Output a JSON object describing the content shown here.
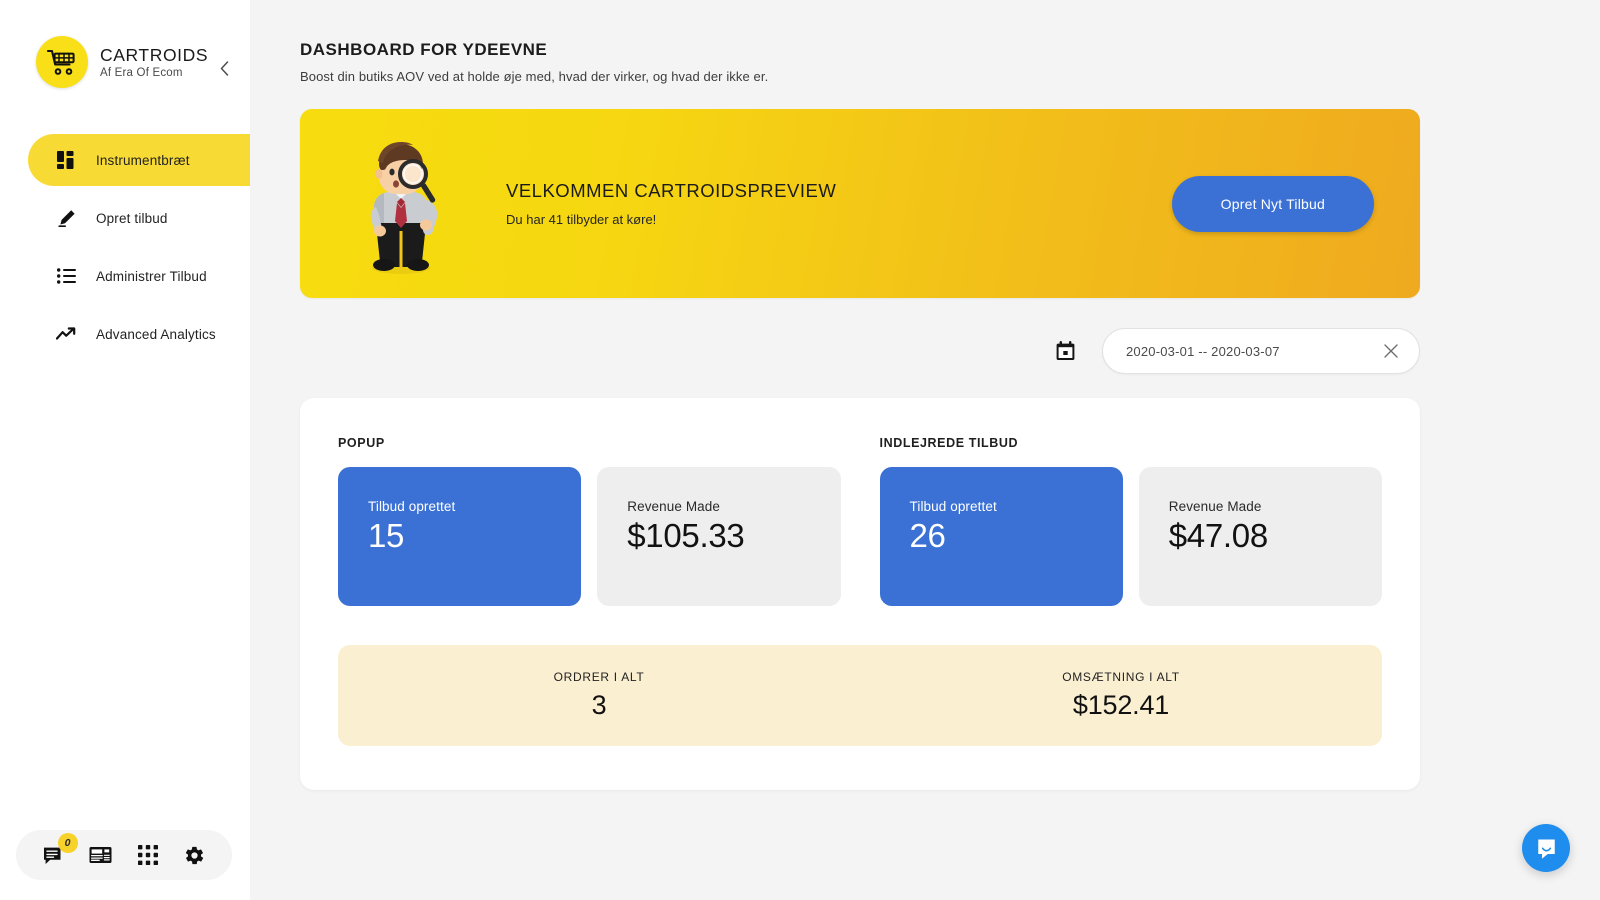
{
  "sidebar": {
    "brand": {
      "title": "CARTROIDS",
      "subtitle": "Af Era Of Ecom"
    },
    "collapse_label": "‹",
    "items": [
      {
        "label": "Instrumentbræt",
        "icon": "dashboard-grid-icon",
        "active": true
      },
      {
        "label": "Opret tilbud",
        "icon": "pencil-icon",
        "active": false
      },
      {
        "label": "Administrer Tilbud",
        "icon": "list-icon",
        "active": false
      },
      {
        "label": "Advanced Analytics",
        "icon": "trend-up-icon",
        "active": false
      }
    ],
    "footer": {
      "messages_badge": "0",
      "icons": [
        "messages-icon",
        "news-icon",
        "apps-grid-icon",
        "gear-icon"
      ]
    }
  },
  "header": {
    "title": "DASHBOARD FOR YDEEVNE",
    "subtitle": "Boost din butiks AOV ved at holde øje med, hvad der virker, og hvad der ikke er."
  },
  "banner": {
    "title": "VELKOMMEN CARTROIDSPREVIEW",
    "description": "Du har 41 tilbyder at køre!",
    "cta_label": "Opret Nyt Tilbud"
  },
  "filter": {
    "calendar_icon": "calendar-icon",
    "date_range_value": "2020-03-01 -- 2020-03-07",
    "date_range_placeholder": "2020-03-01 -- 2020-03-07",
    "clear_icon": "close-icon"
  },
  "stats": {
    "groups": [
      {
        "title": "POPUP",
        "tiles": [
          {
            "label": "Tilbud oprettet",
            "value": "15",
            "style": "primary"
          },
          {
            "label": "Revenue Made",
            "value": "$105.33",
            "style": "muted"
          }
        ]
      },
      {
        "title": "INDLEJREDE TILBUD",
        "tiles": [
          {
            "label": "Tilbud oprettet",
            "value": "26",
            "style": "primary"
          },
          {
            "label": "Revenue Made",
            "value": "$47.08",
            "style": "muted"
          }
        ]
      }
    ],
    "totals": [
      {
        "label": "ORDRER I ALT",
        "value": "3"
      },
      {
        "label": "OMSÆTNING I ALT",
        "value": "$152.41"
      }
    ]
  },
  "chat": {
    "icon": "chat-bubble-icon"
  },
  "colors": {
    "brand_yellow": "#F8DF18",
    "accent_blue": "#3B71D4",
    "banner_from": "#F7DD0F",
    "banner_to": "#EFAA1F",
    "totals_bg": "#FBEFD2",
    "page_bg": "#F4F4F4",
    "chat_blue": "#1F8DED"
  }
}
